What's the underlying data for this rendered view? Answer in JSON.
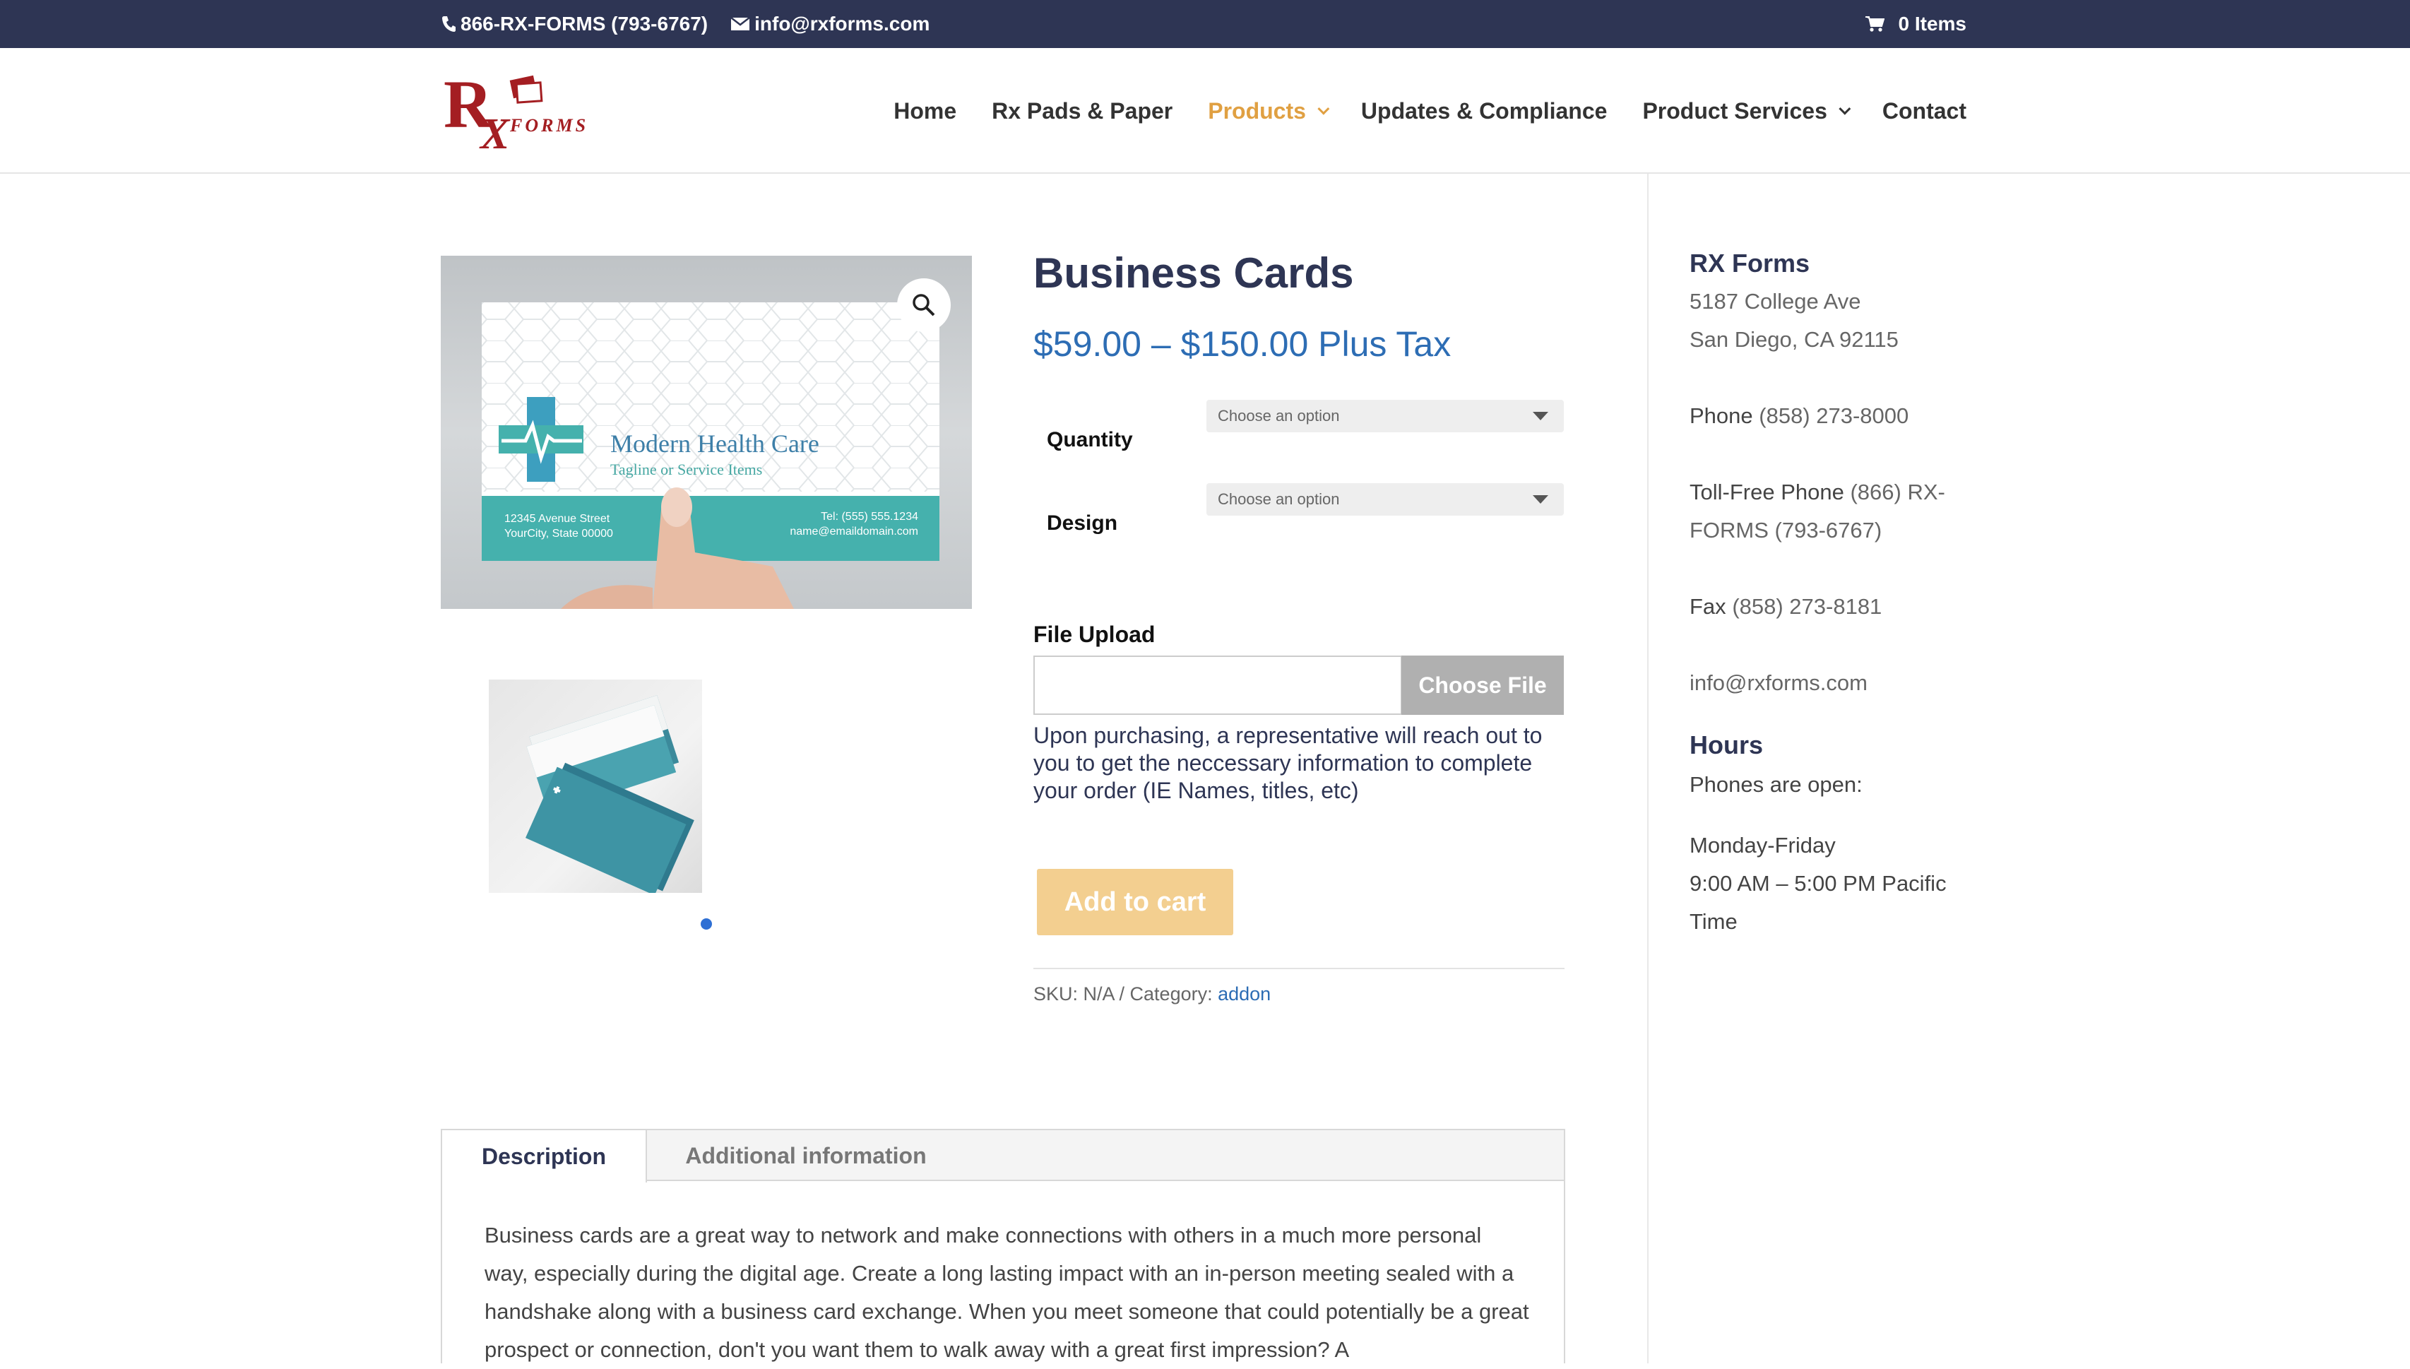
{
  "topbar": {
    "phone": "866-RX-FORMS (793-6767)",
    "email": "info@rxforms.com",
    "cart_label": "0 Items",
    "icons": {
      "phone": "phone-icon",
      "email": "envelope-icon",
      "cart": "cart-icon"
    }
  },
  "logo": {
    "letters": "RX",
    "sub": "FORMS"
  },
  "nav": {
    "home": "Home",
    "rx_pads": "Rx Pads & Paper",
    "products": "Products",
    "updates": "Updates & Compliance",
    "services": "Product Services",
    "contact": "Contact"
  },
  "product": {
    "title": "Business Cards",
    "price": "$59.00 – $150.00 Plus Tax",
    "image_card": {
      "brand": "Modern Health Care",
      "tagline": "Tagline or Service Items",
      "address1": "12345 Avenue Street",
      "address2": "YourCity, State 00000",
      "tel": "Tel: (555) 555.1234",
      "email": "name@emaildomain.com"
    },
    "quantity_label": "Quantity",
    "quantity_value": "Choose an option",
    "design_label": "Design",
    "design_value": "Choose an option",
    "file_upload_label": "File Upload",
    "choose_file": "Choose File",
    "file_note": "Upon purchasing, a representative will reach out to you to get the neccessary information to complete your order (IE Names, titles, etc)",
    "add_to_cart": "Add to cart",
    "meta_prefix": "SKU: N/A / Category: ",
    "category": "addon"
  },
  "tabs": {
    "description": "Description",
    "additional": "Additional information",
    "description_text": "Business cards are a great way to network and make connections with others in a much more personal way, especially during the digital age. Create a long lasting impact with an in-person meeting sealed with a handshake along with a business card exchange. When you meet someone that could potentially be a great prospect or connection, don't you want them to walk away with a great first impression? A"
  },
  "sidebar": {
    "company": "RX Forms",
    "address1": "5187 College Ave",
    "address2": "San Diego, CA 92115",
    "phone_label": "Phone",
    "phone": "(858) 273-8000",
    "tollfree_label": "Toll-Free Phone",
    "tollfree": "(866) RX-FORMS (793-6767)",
    "fax_label": "Fax",
    "fax": "(858) 273-8181",
    "email": "info@rxforms.com",
    "hours_heading": "Hours",
    "phones_open": "Phones are open:",
    "days": "Monday-Friday",
    "time": "9:00 AM – 5:00 PM Pacific Time"
  },
  "colors": {
    "topbar": "#2e3554",
    "accent": "#e0a042",
    "price": "#2d6db4",
    "logo_red": "#a41e22",
    "card_teal": "#45b1ad"
  }
}
